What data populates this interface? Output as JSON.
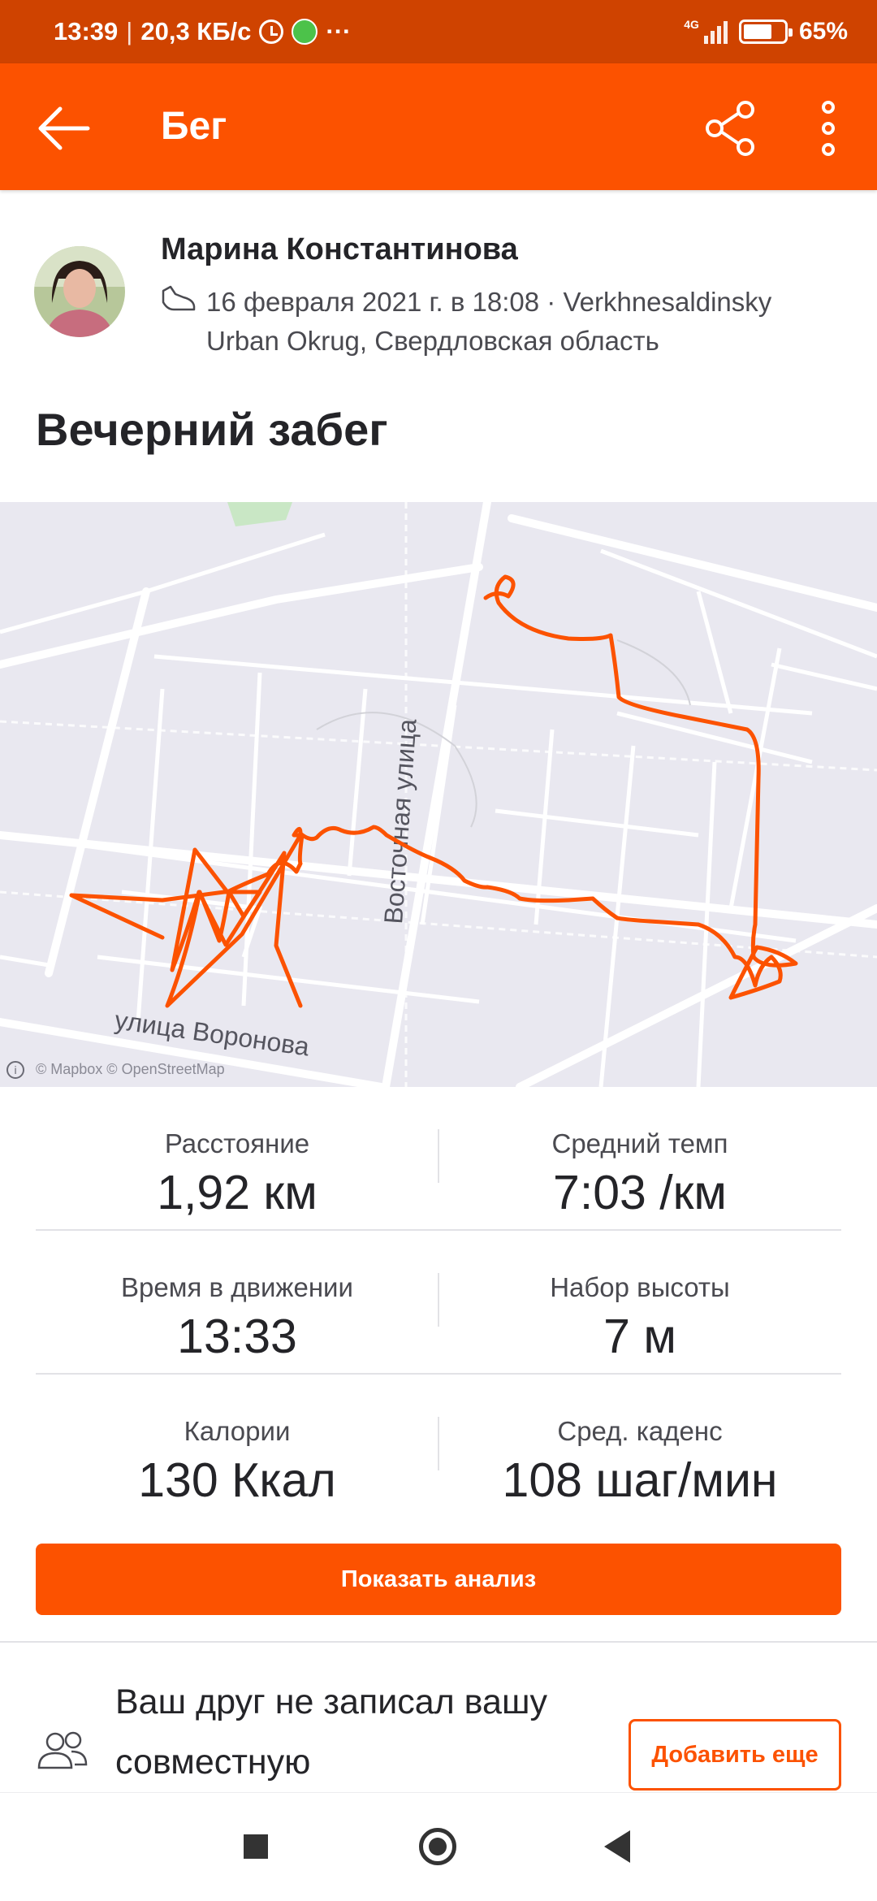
{
  "status_bar": {
    "time": "13:39",
    "speed": "20,3 КБ/с",
    "dots": "···",
    "network": "4G",
    "battery": "65%"
  },
  "app_bar": {
    "title": "Бег",
    "accent_color": "#fc5200"
  },
  "athlete": {
    "name": "Марина Константинова",
    "meta": "16 февраля 2021 г. в 18:08 · Verkhnesaldinsky Urban Okrug, Свердловская область"
  },
  "activity": {
    "title": "Вечерний забег"
  },
  "map": {
    "street_1": "Восточная улица",
    "street_2": "улица Воронова",
    "attribution": "© Mapbox © OpenStreetMap",
    "route_color": "#fc5200"
  },
  "stats": [
    {
      "label": "Расстояние",
      "value": "1,92 км"
    },
    {
      "label": "Средний темп",
      "value": "7:03 /км"
    },
    {
      "label": "Время в движении",
      "value": "13:33"
    },
    {
      "label": "Набор высоты",
      "value": "7 м"
    },
    {
      "label": "Калории",
      "value": "130 Ккал"
    },
    {
      "label": "Сред. каденс",
      "value": "108 шаг/мин"
    }
  ],
  "analysis_button": "Показать анализ",
  "partner": {
    "text": "Ваш друг не записал вашу совместную",
    "button": "Добавить еще"
  }
}
